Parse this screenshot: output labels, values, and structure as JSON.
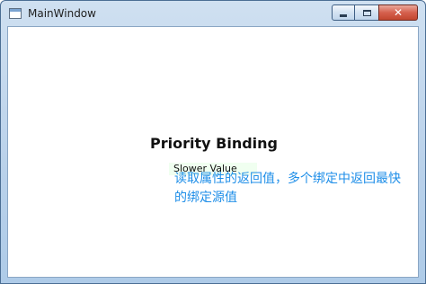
{
  "window": {
    "title": "MainWindow",
    "caption_buttons": {
      "minimize_icon": "minimize-icon",
      "maximize_icon": "maximize-icon",
      "close_icon": "close-icon"
    }
  },
  "content": {
    "heading": "Priority Binding",
    "bound_value": "Slower Value"
  },
  "annotation": {
    "text": "读取属性的返回值，多个绑定中返回最快的绑定源值"
  },
  "colors": {
    "annotation_text": "#1e8ee8",
    "value_background": "#f0fff0",
    "close_button": "#c2462f"
  }
}
